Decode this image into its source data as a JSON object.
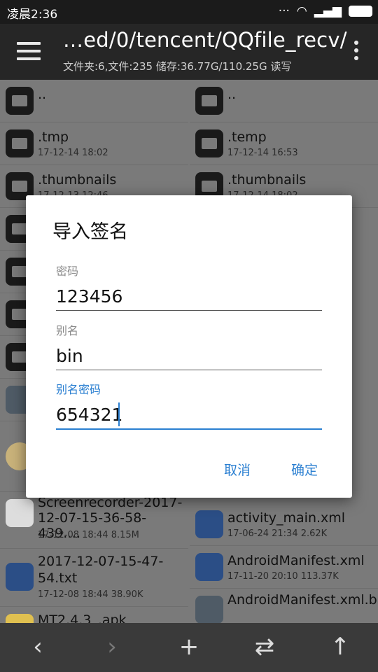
{
  "status": {
    "time": "凌晨2:36"
  },
  "header": {
    "path": "…ed/0/tencent/QQfile_recv/",
    "summary": "文件夹:6,文件:235  储存:36.77G/110.25G  读写"
  },
  "left_pane": [
    {
      "name": "..",
      "meta": ""
    },
    {
      "name": ".tmp",
      "meta": "17-12-14 18:02"
    },
    {
      "name": ".thumbnails",
      "meta": "17-12-13 12:46"
    },
    {
      "name": "Screenrecorder-2017-12-07-15-36-58-439.…",
      "meta": "17-12-08 18:44  8.15M"
    },
    {
      "name": "2017-12-07-15-47-54.txt",
      "meta": "17-12-08 18:44  38.90K"
    },
    {
      "name": "MT2.4.3_.apk",
      "meta": ""
    }
  ],
  "right_pane": [
    {
      "name": "..",
      "meta": ""
    },
    {
      "name": ".temp",
      "meta": "17-12-14 16:53"
    },
    {
      "name": ".thumbnails",
      "meta": "17-12-14 18:02"
    },
    {
      "name": "activity_main.xml",
      "meta": "17-06-24 21:34  2.62K"
    },
    {
      "name": "AndroidManifest.xml",
      "meta": "17-11-20 20:10  113.37K"
    },
    {
      "name": "AndroidManifest.xml.bak",
      "meta": ""
    }
  ],
  "dialog": {
    "title": "导入签名",
    "password_label": "密码",
    "password_value": "123456",
    "alias_label": "别名",
    "alias_value": "bin",
    "alias_password_label": "别名密码",
    "alias_password_value": "654321",
    "cancel": "取消",
    "ok": "确定"
  },
  "bottom": {
    "back": "‹",
    "forward": "›",
    "add": "+",
    "swap": "⇄",
    "up": "↑"
  },
  "colors": {
    "accent": "#2a7fd1",
    "appbar": "#262626"
  }
}
